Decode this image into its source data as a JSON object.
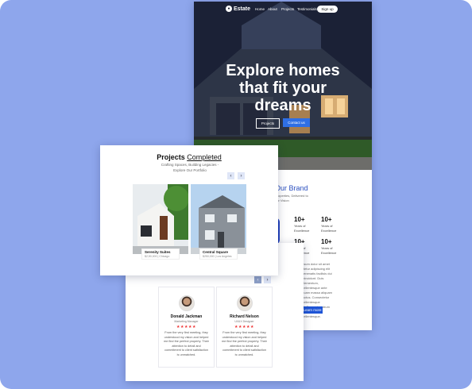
{
  "landing": {
    "logo": "Estate",
    "nav": [
      "Home",
      "About",
      "Projects",
      "Testimonials"
    ],
    "signup": "Sign up",
    "hero_lines": [
      "Explore homes",
      "that fit your",
      "dreams"
    ],
    "btn_projects": "Projects",
    "btn_contact": "Contact us",
    "brand_title": "Our Brand",
    "brand_sub": "Properties, Delivered to\nour Vision",
    "stats": [
      {
        "value": "10+",
        "label": "Years of\nExcellence"
      },
      {
        "value": "10+",
        "label": "Years of\nExcellence"
      },
      {
        "value": "10+",
        "label": "Years of\nExcellence"
      },
      {
        "value": "10+",
        "label": "Years of\nExcellence"
      }
    ],
    "lorem": "psum dolor sit amet\nctetur adipiscing elit\nvenenatis facilisis dui\nmincidunt. Duis\nelementum, pellentesque ante\nquam massa aliquam\nluctus. Consectetur pellentesque\nat. Sem quis rutrum\nsapien eget pellentesque.",
    "more_btn": "Learn more"
  },
  "projects": {
    "title_bold": "Projects",
    "title_link": "Completed",
    "subtitle": "Crafting Spaces, Building Legacies - Explore Our Portfolio",
    "items": [
      {
        "name": "Serenity Suites",
        "meta": "$2,50,000 | Chicago"
      },
      {
        "name": "Central Square",
        "meta": "$250,000 | Los Angeles"
      }
    ]
  },
  "testimonials": {
    "cards": [
      {
        "name": "Donald Jackman",
        "role": "Marketing Manager",
        "stars": "★★★★★",
        "quote": "From the very first meeting, they understood my vision and helped me find the perfect property. Their attention to detail and commitment to client satisfaction is unmatched."
      },
      {
        "name": "Richard Nelson",
        "role": "UI/UX Designer",
        "stars": "★★★★★",
        "quote": "From the very first meeting, they understood my vision and helped me find the perfect property. Their attention to detail and commitment to client satisfaction is unmatched."
      }
    ]
  },
  "colors": {
    "background": "#8ea6ec",
    "accent": "#2f6fe4",
    "stars": "#ee3333"
  },
  "icons": [
    "logo-mark-icon",
    "chevron-left-icon",
    "chevron-right-icon"
  ]
}
